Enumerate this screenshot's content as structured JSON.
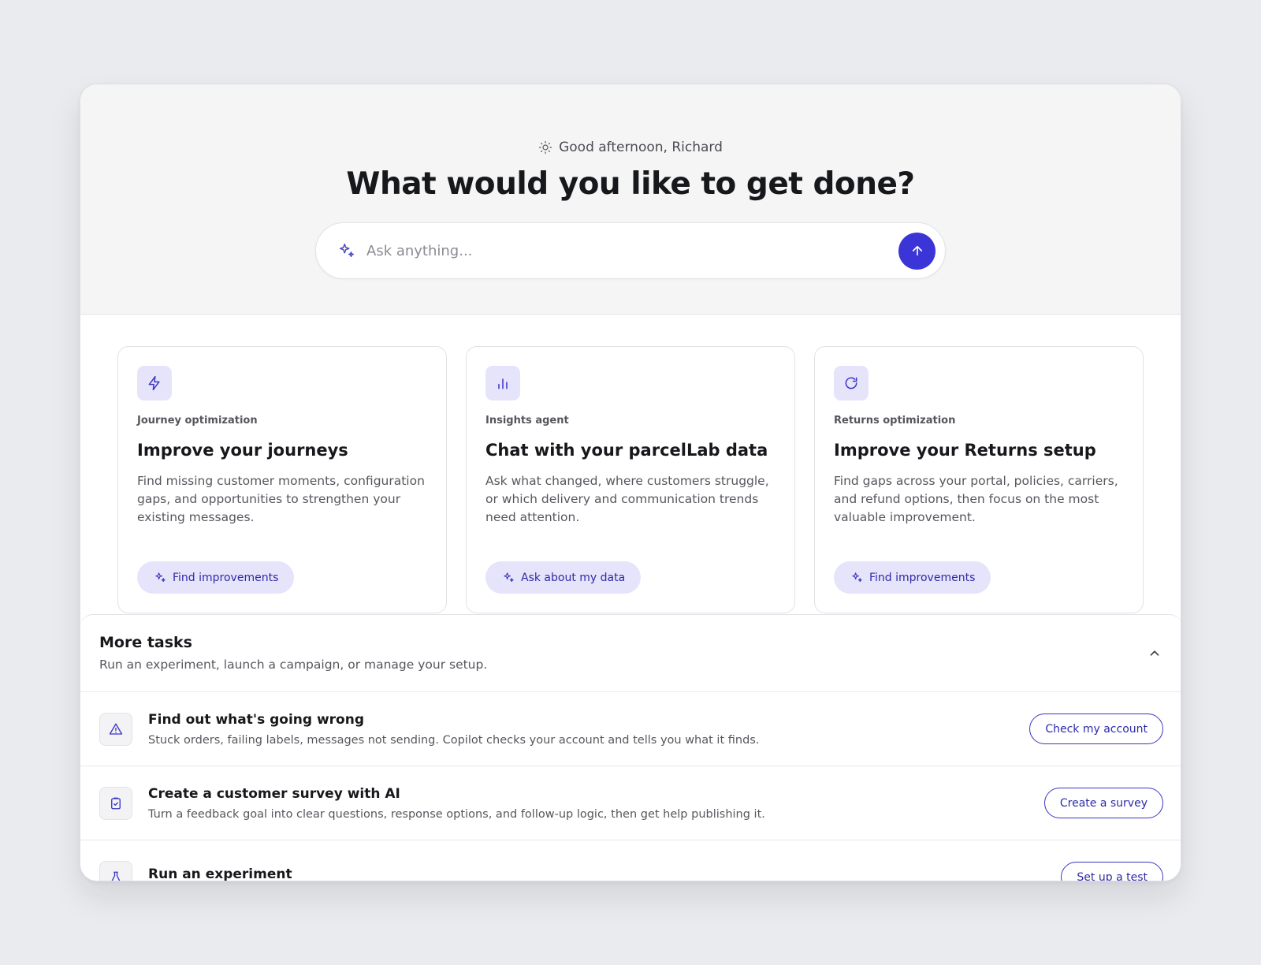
{
  "hero": {
    "greeting": "Good afternoon, Richard",
    "headline": "What would you like to get done?",
    "ask_placeholder": "Ask anything...",
    "accent": "#3b35d8"
  },
  "cards": [
    {
      "icon": "lightning-icon",
      "eyebrow": "Journey optimization",
      "title": "Improve your journeys",
      "description": "Find missing customer moments, configuration gaps, and opportunities to strengthen your existing messages.",
      "action": "Find improvements"
    },
    {
      "icon": "bar-chart-icon",
      "eyebrow": "Insights agent",
      "title": "Chat with your parcelLab data",
      "description": "Ask what changed, where customers struggle, or which delivery and communication trends need attention.",
      "action": "Ask about my data"
    },
    {
      "icon": "refresh-icon",
      "eyebrow": "Returns optimization",
      "title": "Improve your Returns setup",
      "description": "Find gaps across your portal, policies, carriers, and refund options, then focus on the most valuable improvement.",
      "action": "Find improvements"
    }
  ],
  "more_tasks": {
    "title": "More tasks",
    "subtitle": "Run an experiment, launch a campaign, or manage your setup.",
    "items": [
      {
        "icon": "warning-triangle-icon",
        "title": "Find out what's going wrong",
        "description": "Stuck orders, failing labels, messages not sending. Copilot checks your account and tells you what it finds.",
        "action": "Check my account"
      },
      {
        "icon": "clipboard-check-icon",
        "title": "Create a customer survey with AI",
        "description": "Turn a feedback goal into clear questions, response options, and follow-up logic, then get help publishing it.",
        "action": "Create a survey"
      },
      {
        "icon": "flask-icon",
        "title": "Run an experiment",
        "description": "",
        "action": "Set up a test"
      }
    ]
  }
}
